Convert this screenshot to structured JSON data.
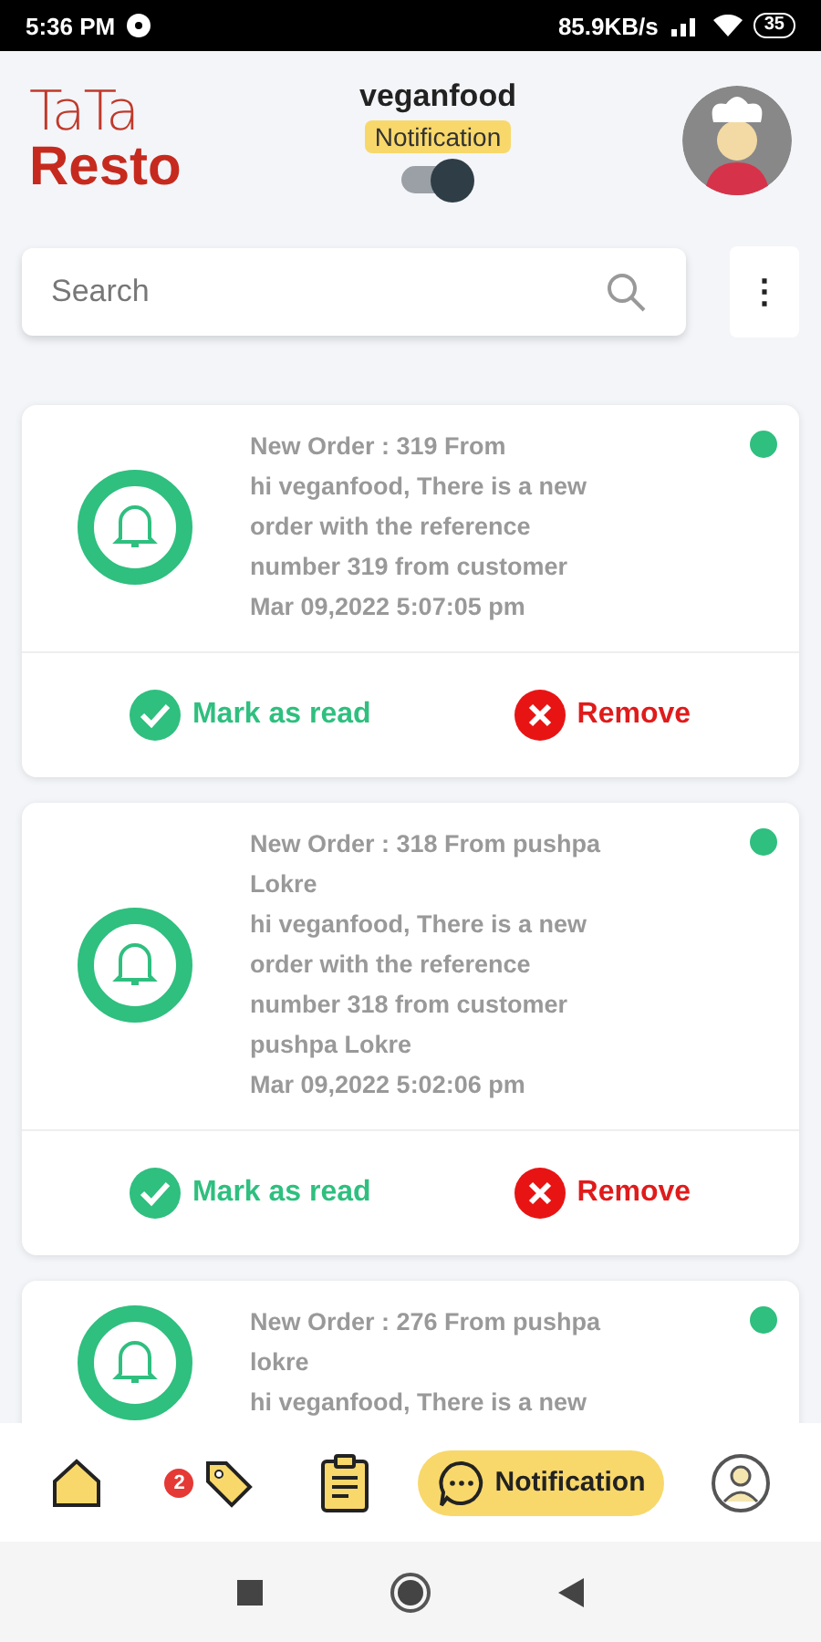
{
  "status_bar": {
    "time": "5:36 PM",
    "speed": "85.9KB/s",
    "battery": "35"
  },
  "header": {
    "logo_top": "TaTa",
    "logo_bottom": "Resto",
    "user": "veganfood",
    "badge": "Notification",
    "toggle": {
      "on": true
    }
  },
  "search": {
    "placeholder": "Search"
  },
  "menu_button": "⋮",
  "notifications": [
    {
      "title": "New Order : 319 From",
      "message": "hi veganfood, There is a new order with the reference number 319 from customer",
      "date": "Mar 09,2022 5:07:05 pm",
      "unread": true,
      "actions": [
        {
          "kind": "read",
          "label": "Mark as read"
        },
        {
          "kind": "remove",
          "label": "Remove"
        }
      ]
    },
    {
      "title": "New Order : 318 From pushpa Lokre",
      "message": "hi veganfood, There is a new order with the reference number 318 from customer pushpa Lokre",
      "date": "Mar 09,2022 5:02:06 pm",
      "unread": true,
      "actions": [
        {
          "kind": "read",
          "label": "Mark as read"
        },
        {
          "kind": "remove",
          "label": "Remove"
        }
      ]
    },
    {
      "title": "New Order : 276 From pushpa lokre",
      "message": "hi veganfood, There is a new",
      "unread": true
    }
  ],
  "bottom_nav": [
    {
      "kind": "home",
      "selected": false
    },
    {
      "kind": "tag",
      "badge": "2",
      "selected": false
    },
    {
      "kind": "clipboard",
      "selected": false
    },
    {
      "kind": "chat",
      "label": "Notification",
      "selected": true
    },
    {
      "kind": "profile",
      "selected": false
    }
  ]
}
